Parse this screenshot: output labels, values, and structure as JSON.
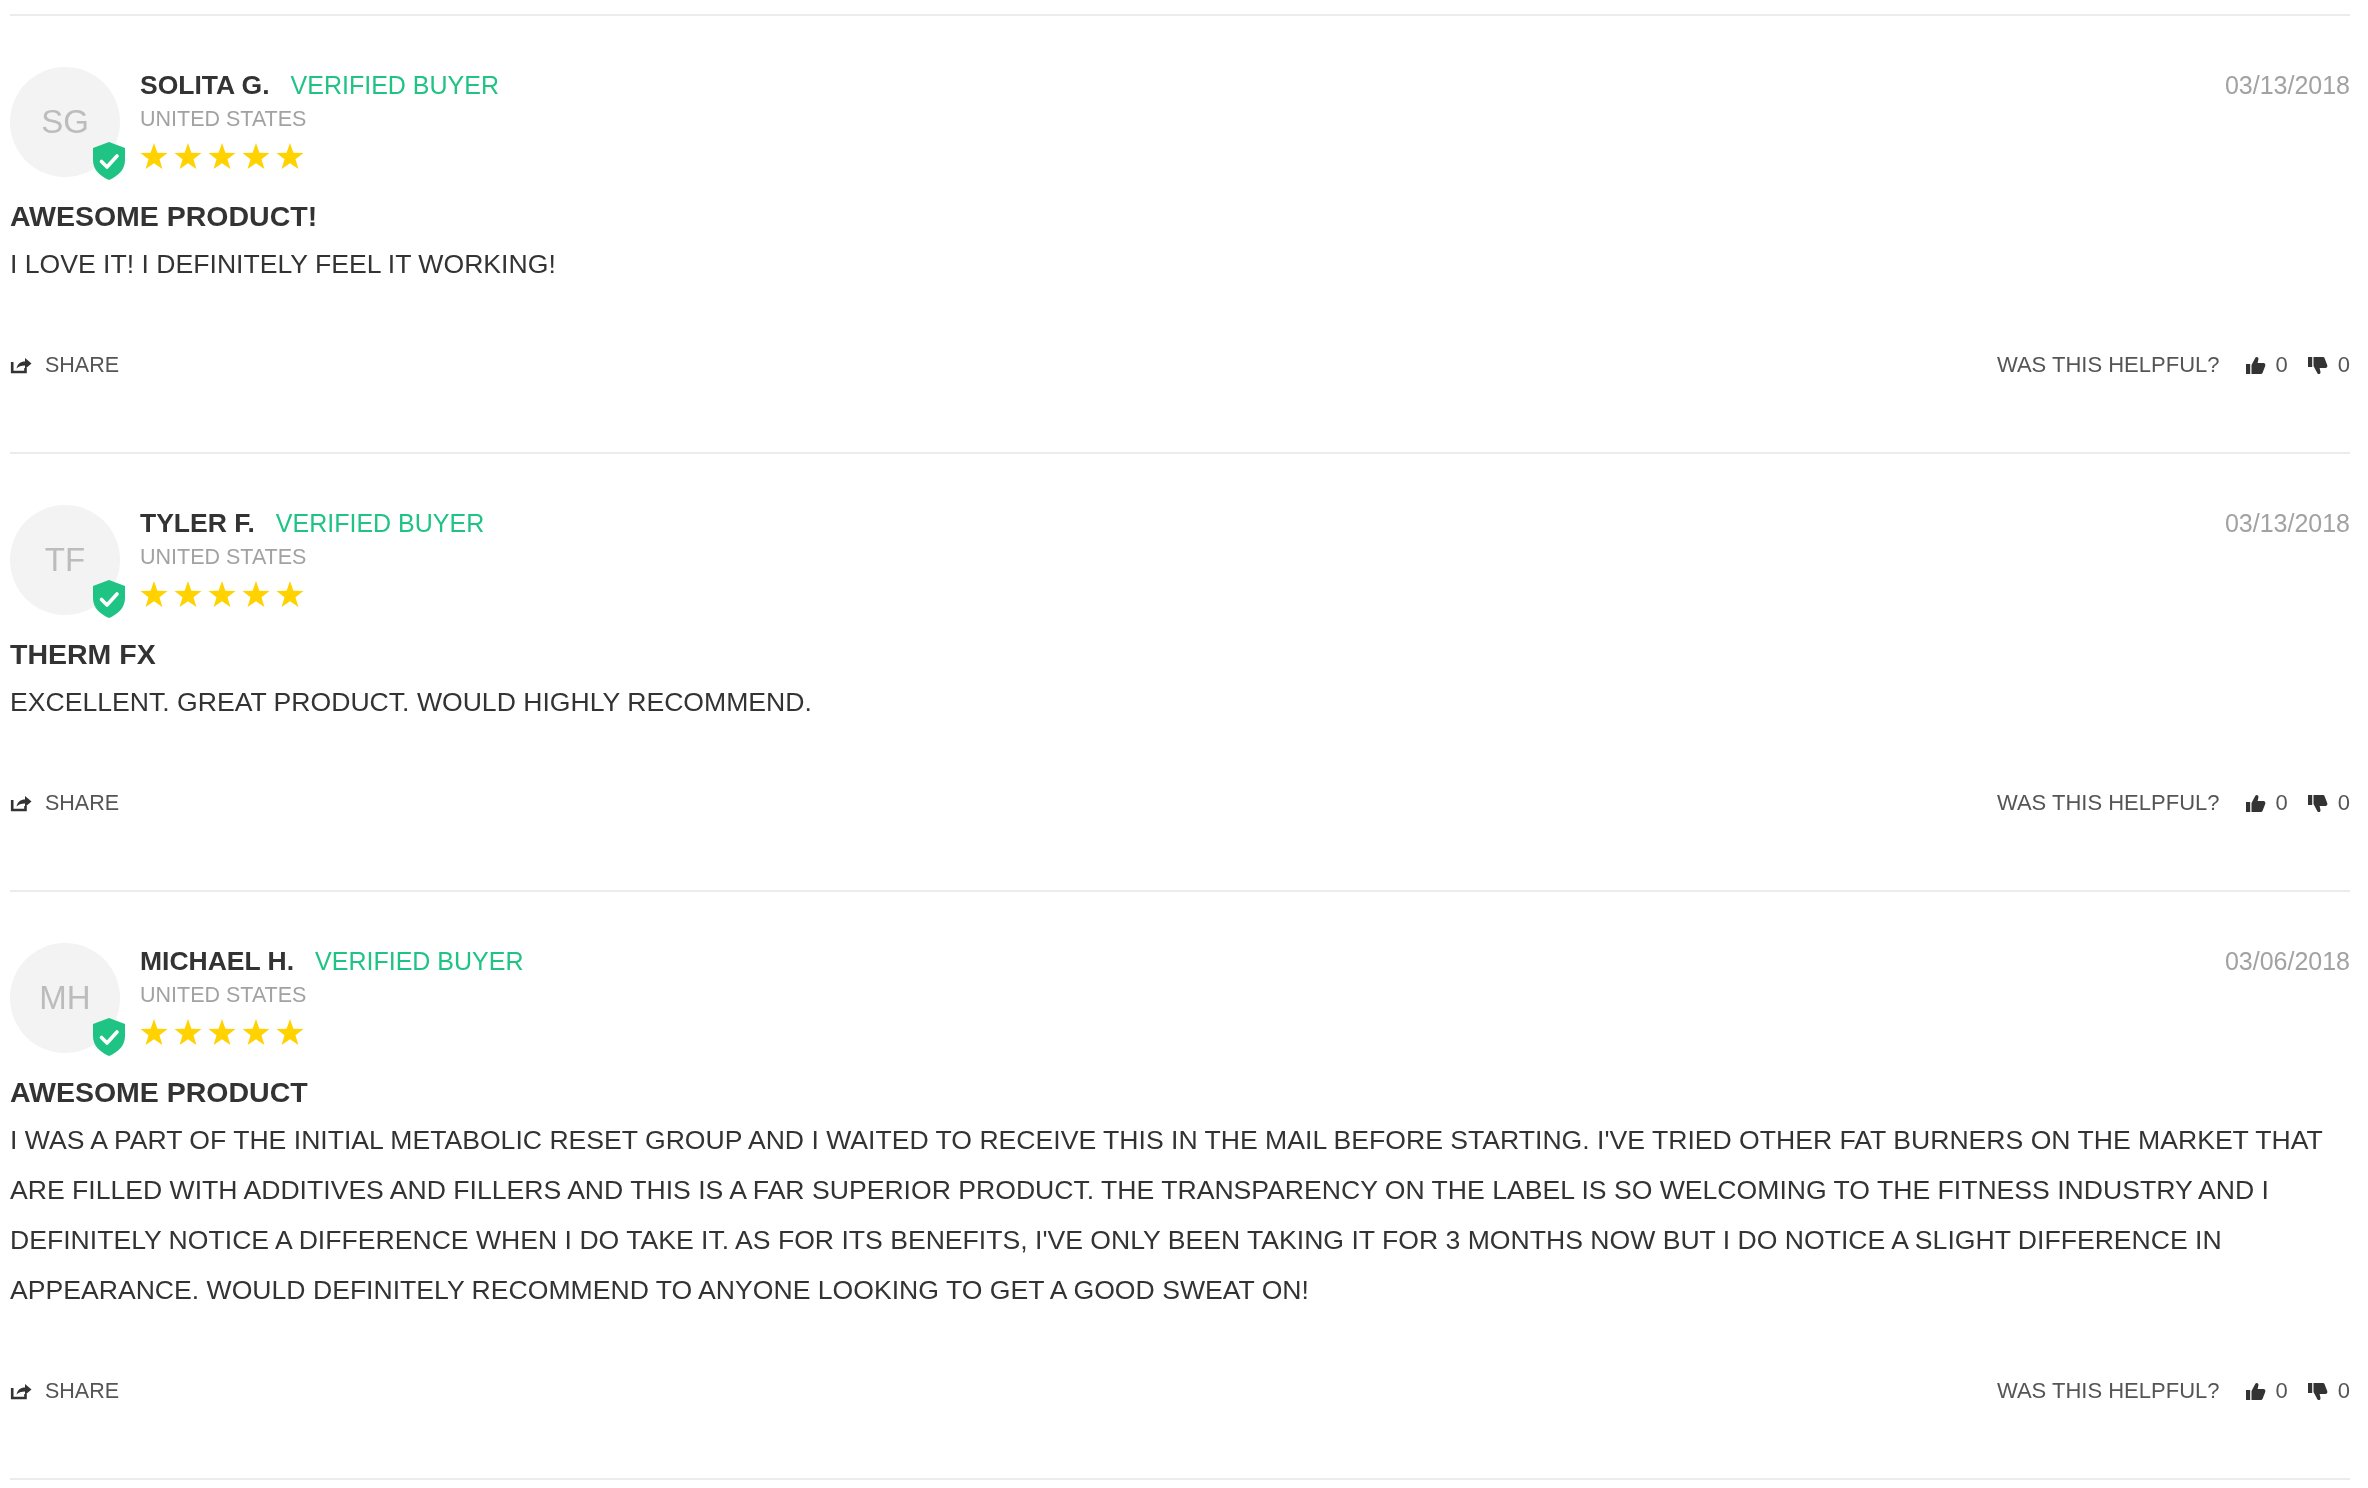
{
  "reviews": [
    {
      "initials": "SG",
      "verified": true,
      "name": "SOLITA G.",
      "badge": "VERIFIED BUYER",
      "location": "UNITED STATES",
      "stars": 5,
      "date": "03/13/2018",
      "title": "AWESOME PRODUCT!",
      "body": "I LOVE IT! I DEFINITELY FEEL IT WORKING!",
      "share": "SHARE",
      "helpful_label": "WAS THIS HELPFUL?",
      "up_votes": "0",
      "down_votes": "0"
    },
    {
      "initials": "TF",
      "verified": true,
      "name": "TYLER F.",
      "badge": "VERIFIED BUYER",
      "location": "UNITED STATES",
      "stars": 5,
      "date": "03/13/2018",
      "title": "THERM FX",
      "body": "EXCELLENT. GREAT PRODUCT. WOULD HIGHLY RECOMMEND.",
      "share": "SHARE",
      "helpful_label": "WAS THIS HELPFUL?",
      "up_votes": "0",
      "down_votes": "0"
    },
    {
      "initials": "MH",
      "verified": true,
      "name": "MICHAEL H.",
      "badge": "VERIFIED BUYER",
      "location": "UNITED STATES",
      "stars": 5,
      "date": "03/06/2018",
      "title": "AWESOME PRODUCT",
      "body": "I WAS A PART OF THE INITIAL METABOLIC RESET GROUP AND I WAITED TO RECEIVE THIS IN THE MAIL BEFORE STARTING. I'VE TRIED OTHER FAT BURNERS ON THE MARKET THAT ARE FILLED WITH ADDITIVES AND FILLERS AND THIS IS A FAR SUPERIOR PRODUCT. THE TRANSPARENCY ON THE LABEL IS SO WELCOMING TO THE FITNESS INDUSTRY AND I DEFINITELY NOTICE A DIFFERENCE WHEN I DO TAKE IT. AS FOR ITS BENEFITS, I'VE ONLY BEEN TAKING IT FOR 3 MONTHS NOW BUT I DO NOTICE A SLIGHT DIFFERENCE IN APPEARANCE. WOULD DEFINITELY RECOMMEND TO ANYONE LOOKING TO GET A GOOD SWEAT ON!",
      "share": "SHARE",
      "helpful_label": "WAS THIS HELPFUL?",
      "up_votes": "0",
      "down_votes": "0"
    }
  ]
}
